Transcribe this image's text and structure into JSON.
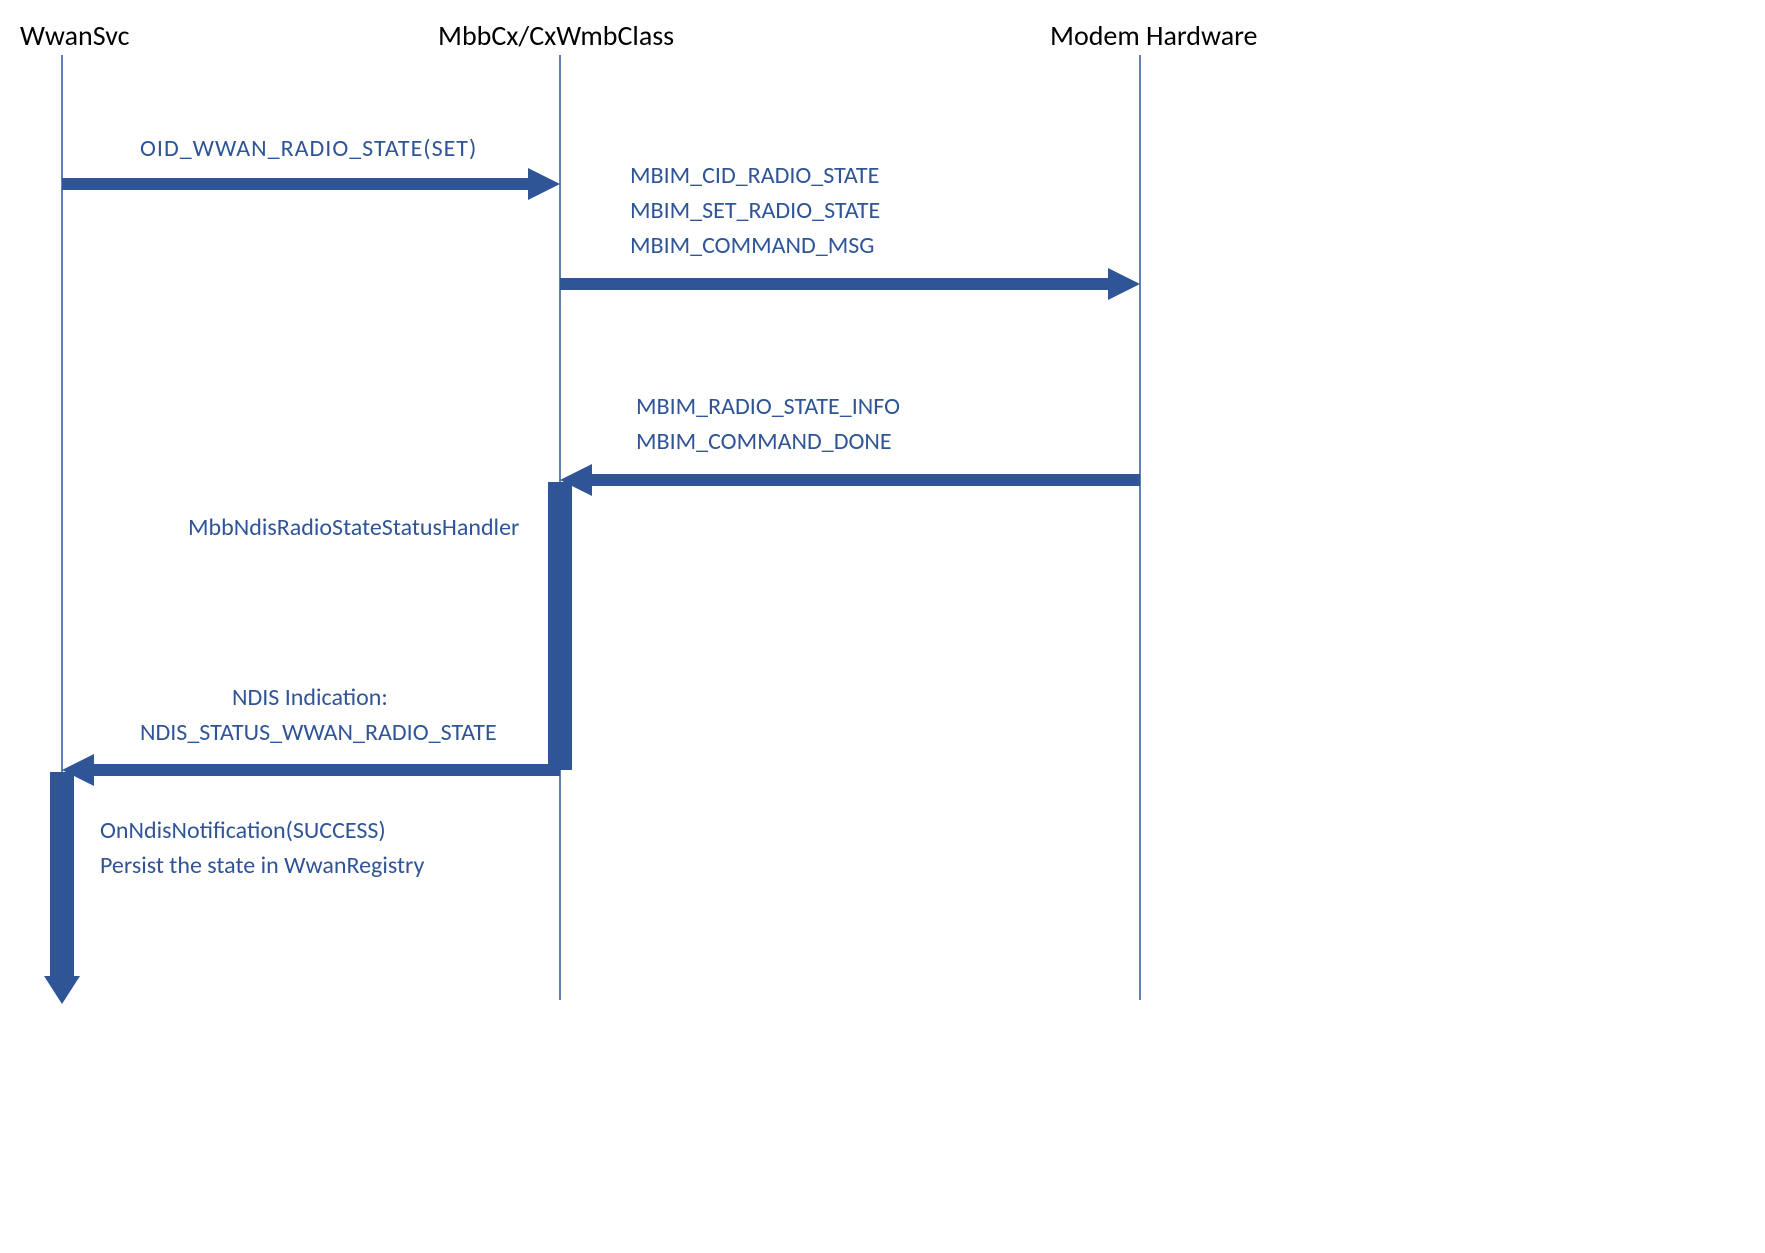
{
  "lanes": {
    "left": "WwanSvc",
    "middle": "MbbCx/CxWmbClass",
    "right": "Modem Hardware"
  },
  "messages": {
    "m1": "OID_WWAN_RADIO_STATE(SET)",
    "m2a": "MBIM_CID_RADIO_STATE",
    "m2b": "MBIM_SET_RADIO_STATE",
    "m2c": "MBIM_COMMAND_MSG",
    "m3a": "MBIM_RADIO_STATE_INFO",
    "m3b": "MBIM_COMMAND_DONE",
    "m4": "MbbNdisRadioStateStatusHandler",
    "m5a": "NDIS Indication:",
    "m5b": "NDIS_STATUS_WWAN_RADIO_STATE",
    "m6a": "OnNdisNotification(SUCCESS)",
    "m6b": "Persist the state in WwanRegistry"
  },
  "colors": {
    "accent": "#2f5597",
    "text": "#000000"
  }
}
